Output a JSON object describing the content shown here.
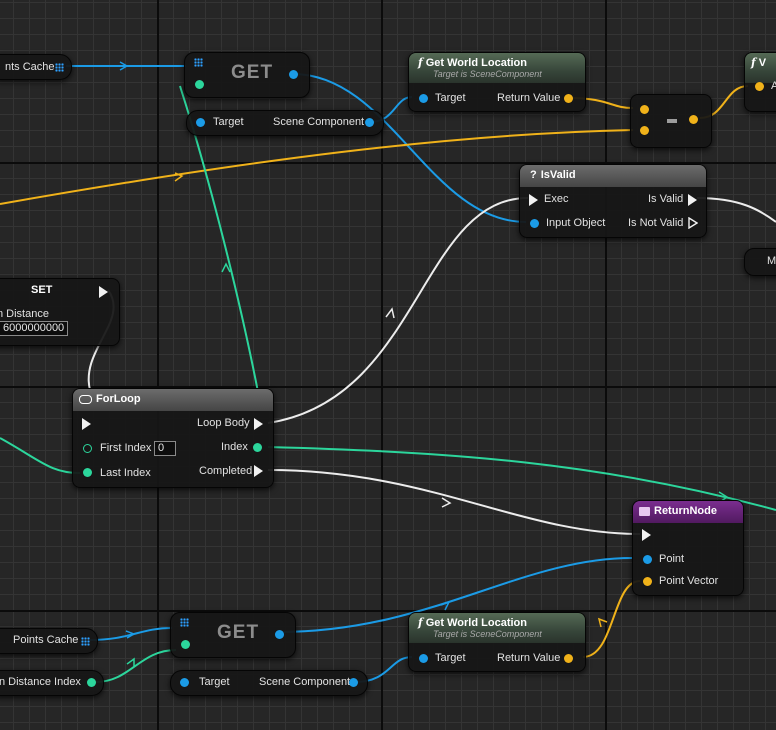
{
  "graph": {
    "colors": {
      "object_pin": "#1b9be6",
      "vector_pin": "#f0b21a",
      "int_pin": "#2cd69c",
      "exec_wire": "#ececec",
      "function_header": "#4c5f4e",
      "return_header": "#6a2580"
    },
    "nodes": {
      "points_cache_var_top": {
        "label": "nts Cache",
        "icon": "array-grid-icon"
      },
      "get_top": {
        "title": "GET",
        "icon": "array-grid-icon",
        "target_label": "Target",
        "type_label": "Scene Component"
      },
      "get_world_location_top": {
        "icon": "function-icon",
        "title": "Get World Location",
        "subtitle": "Target is SceneComponent",
        "target_label": "Target",
        "return_label": "Return Value"
      },
      "vector_op": {
        "symbol": "-"
      },
      "partial_function_node": {
        "title": "V",
        "pin_label": "A"
      },
      "is_valid": {
        "icon": "question-icon",
        "title": "IsValid",
        "exec_label": "Exec",
        "input_label": "Input Object",
        "valid_label": "Is Valid",
        "not_valid_label": "Is Not Valid"
      },
      "partial_right_node": {
        "label": "M"
      },
      "set_node": {
        "title": "SET",
        "var_label": "n Distance",
        "value": "6000000000"
      },
      "for_loop": {
        "icon": "loop-icon",
        "title": "ForLoop",
        "loop_body_label": "Loop Body",
        "first_index_label": "First Index",
        "first_index_value": "0",
        "index_label": "Index",
        "last_index_label": "Last Index",
        "completed_label": "Completed"
      },
      "return_node": {
        "icon": "return-icon",
        "title": "ReturnNode",
        "point_label": "Point",
        "point_vector_label": "Point Vector"
      },
      "points_cache_var_bottom": {
        "label": "Points Cache",
        "icon": "array-grid-icon"
      },
      "distance_index_var": {
        "label": "n Distance Index"
      },
      "get_bottom": {
        "title": "GET",
        "icon": "array-grid-icon",
        "target_label": "Target",
        "type_label": "Scene Component"
      },
      "get_world_location_bottom": {
        "icon": "function-icon",
        "title": "Get World Location",
        "subtitle": "Target is SceneComponent",
        "target_label": "Target",
        "return_label": "Return Value"
      }
    }
  }
}
